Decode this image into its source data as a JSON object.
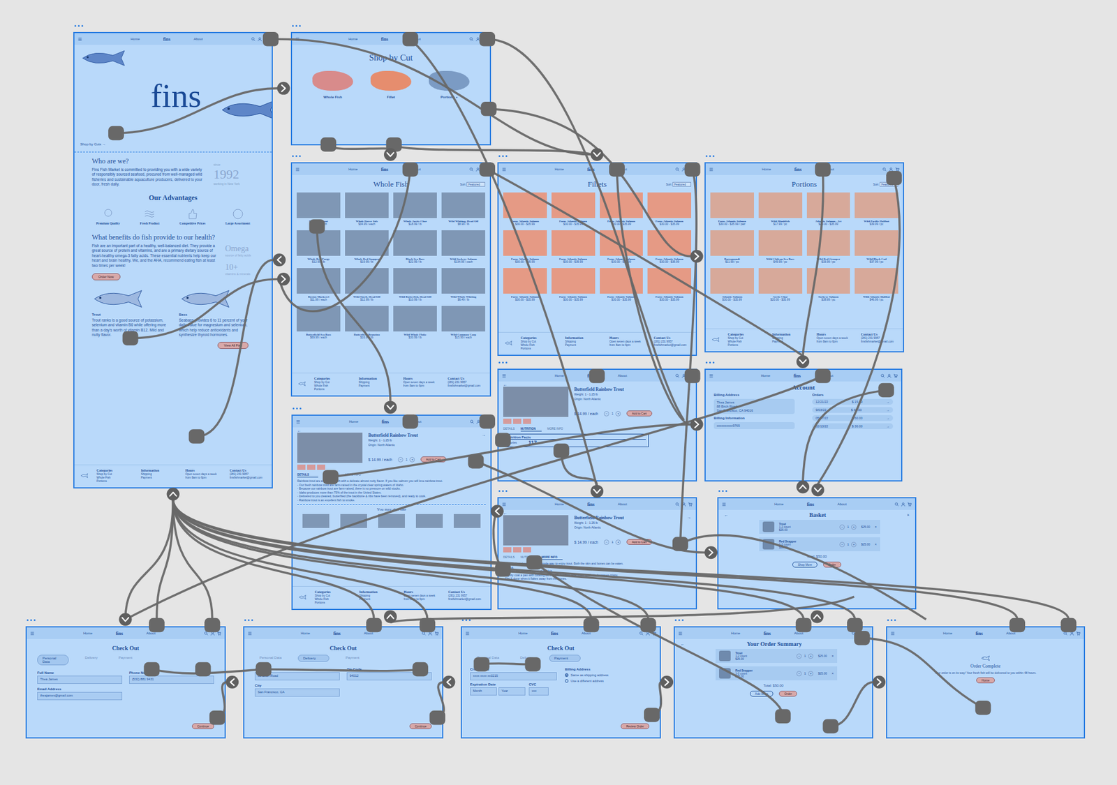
{
  "nav": {
    "home": "Home",
    "logo": "fins",
    "about": "About"
  },
  "controls": {
    "minus": "−",
    "plus": "+",
    "remove": "×",
    "back": "←",
    "next": "→"
  },
  "footer": {
    "columns": [
      {
        "title": "Categories",
        "items": [
          "Shop by Cut",
          "Whole Fish",
          "Portions"
        ]
      },
      {
        "title": "Information",
        "items": [
          "Shipping",
          "Payment"
        ]
      },
      {
        "title": "Hours",
        "items": [
          "Open seven days a week",
          "from 8am to 6pm"
        ]
      },
      {
        "title": "Contact Us",
        "items": [
          "(281) 231 9957",
          "finsfishmarket@gmail.com"
        ]
      }
    ]
  },
  "frames": [
    {
      "kind": "home",
      "logo": "fins",
      "shop_link": "Shop by Cuts →",
      "who_title": "Who are we?",
      "who_text": "Fins Fish Market is committed to providing you with a wide variety of responsibly sourced seafood, procured from well-managed wild fisheries and sustainable aquaculture producers, delivered to your door, fresh daily.",
      "since_label": "since",
      "year": "1992",
      "year_sub": "working in New York",
      "advantages_title": "Our Advantages",
      "advantages": [
        "Premium Quality",
        "Fresh Product",
        "Competitive Prices",
        "Large Assortment"
      ],
      "benefits_title": "What benefits do fish provide to our health?",
      "benefits_text": "Fish are an important part of a healthy, well-balanced diet. They provide a great source of protein and vitamins, and are a primary dietary source of heart-healthy omega-3 fatty acids. These essential nutrients help keep our heart and brain healthy. We, and the AHA, recommend eating fish at least two times per week!",
      "order_button": "Order Now",
      "stats": [
        {
          "value": "Omega",
          "label": "source of fatty acids"
        },
        {
          "value": "10+",
          "label": "vitamins & minerals"
        }
      ],
      "fish": [
        {
          "name": "Trout",
          "text": "Trout ranks is a good source of potassium, selenium and vitamin B6 while offering more than a day's worth of vitamin B12. Mild and nutty flavor."
        },
        {
          "name": "Bass",
          "text": "Seabass provides 6 to 11 percent of your daily value for magnesium and selenium, which help reduce antioxidants and synthesize thyroid hormones."
        }
      ],
      "view_button": "View All Fish"
    },
    {
      "kind": "cuts",
      "title": "Shop by Cut",
      "cuts": [
        "Whole Fish",
        "Fillet",
        "Portions +"
      ]
    },
    {
      "kind": "grid",
      "title": "Whole Fish",
      "sort_label": "Sort",
      "sort_value": "Featured",
      "items": [
        {
          "name": "Rainbow Trout",
          "price": "$14.99 / each"
        },
        {
          "name": "Whole Dover Sole",
          "price": "$34.99 / each"
        },
        {
          "name": "Whole Arctic Char",
          "price": "$18.99 / lb"
        },
        {
          "name": "Wild Whiting, Head Off",
          "price": "$8.99 / lb"
        },
        {
          "name": "Whole Red Porgy",
          "price": "$12.99 / lb"
        },
        {
          "name": "Whole Red Snapper",
          "price": "$19.99 / lb"
        },
        {
          "name": "Black Sea Bass",
          "price": "$22.99 / lb"
        },
        {
          "name": "Wild Sockeye Salmon",
          "price": "$134.99 / each"
        },
        {
          "name": "Boston Mackerel",
          "price": "$11.99 / each"
        },
        {
          "name": "Wild Smelt, Head Off",
          "price": "$12.99 / lb"
        },
        {
          "name": "Wild Butterfish, Head Off",
          "price": "$10.99 / lb"
        },
        {
          "name": "Wild Whole Whiting",
          "price": "$6.49 / lb"
        },
        {
          "name": "Butterfield Sea Bass",
          "price": "$69.99 / each"
        },
        {
          "name": "Butterfield Branzino",
          "price": "$16.99 / lb"
        },
        {
          "name": "Wild Whole Fluke",
          "price": "$30.99 / lb"
        },
        {
          "name": "Wild Common Carp",
          "price": "$15.99 / each"
        }
      ]
    },
    {
      "kind": "grid",
      "title": "Fillets",
      "sort_label": "Sort",
      "sort_value": "Featured",
      "items": [
        {
          "name": "Faroe Atlantic Salmon",
          "price": "$30.00 - $35.99"
        },
        {
          "name": "Faroe Atlantic Salmon",
          "price": "$30.00 - $35.99"
        },
        {
          "name": "Faroe Atlantic Salmon",
          "price": "$30.00 - $35.99"
        },
        {
          "name": "Faroe Atlantic Salmon",
          "price": "$30.00 - $35.99"
        },
        {
          "name": "Faroe Atlantic Salmon",
          "price": "$30.00 - $35.99"
        },
        {
          "name": "Faroe Atlantic Salmon",
          "price": "$30.00 - $35.99"
        },
        {
          "name": "Faroe Atlantic Salmon",
          "price": "$30.00 - $35.99"
        },
        {
          "name": "Faroe Atlantic Salmon",
          "price": "$30.00 - $35.99"
        },
        {
          "name": "Faroe Atlantic Salmon",
          "price": "$30.00 - $35.99"
        },
        {
          "name": "Faroe Atlantic Salmon",
          "price": "$30.00 - $35.99"
        },
        {
          "name": "Faroe Atlantic Salmon",
          "price": "$30.00 - $35.99"
        },
        {
          "name": "Faroe Atlantic Salmon",
          "price": "$30.00 - $35.99"
        }
      ]
    },
    {
      "kind": "grid",
      "title": "Portions",
      "sort_label": "Sort",
      "sort_value": "Featured",
      "items": [
        {
          "name": "Faroe Atlantic Salmon",
          "price": "$30.00 - $35.99 / pair"
        },
        {
          "name": "Wild Monkfish",
          "price": "$17.99 / pc"
        },
        {
          "name": "Atlantic Salmon - 2ct",
          "price": "$20.00 - $35.99"
        },
        {
          "name": "Wild Pacific Halibut",
          "price": "$39.99 / pc"
        },
        {
          "name": "Barramundi",
          "price": "$11.99 / pc"
        },
        {
          "name": "Wild Chilean Sea Bass",
          "price": "$49.99 / pc"
        },
        {
          "name": "Wild Red Grouper",
          "price": "$33.99 / pc"
        },
        {
          "name": "Wild Black Cod",
          "price": "$37.99 / pc"
        },
        {
          "name": "Atlantic Salmon",
          "price": "$30.00 - $35.99"
        },
        {
          "name": "Arctic Char",
          "price": "$20.00 - $35.99"
        },
        {
          "name": "Sockeye Salmon",
          "price": "$39.89 / pc"
        },
        {
          "name": "Wild Atlantic Halibut",
          "price": "$46.99 / pc"
        }
      ]
    },
    {
      "kind": "product",
      "variant": "details",
      "name": "Butterfield Rainbow Trout",
      "weight": "Weight: 1 - 1.25 lb",
      "origin": "Origin: North Atlantic",
      "price": "$ 14.99 / each",
      "qty": "1",
      "button": "Add to Cart",
      "tabs": [
        {
          "label": "DETAILS",
          "selected": true
        },
        {
          "label": "NUTRITION",
          "selected": false
        },
        {
          "label": "MORE INFO",
          "selected": false
        }
      ],
      "description": [
        "Rainbow trout are a soft flaky fish with a delicate almost nutty flavor. If you like salmon you will love rainbow trout.",
        "- Our fresh rainbow trout are farm-raised in the crystal clear spring waters of Idaho.",
        "- Because our rainbow trout are farm-raised, there is no pressure on wild stocks.",
        "- Idaho produces more than 75% of the trout in the United States.",
        "- Delivered to you cleaned, butterflied (the backbone & ribs have been removed), and ready to cook.",
        "- Rainbow trout is an excellent fish to smoke."
      ],
      "also_like": "You may also like"
    },
    {
      "kind": "product",
      "variant": "nutrition",
      "name": "Butterfield Rainbow Trout",
      "weight": "Weight: 1 - 1.25 lb",
      "origin": "Origin: North Atlantic",
      "price": "$ 14.99 / each",
      "qty": "1",
      "button": "Add to Cart",
      "tabs": [
        {
          "label": "DETAILS",
          "selected": false
        },
        {
          "label": "NUTRITION",
          "selected": true
        },
        {
          "label": "MORE INFO",
          "selected": false
        }
      ],
      "nutrition": {
        "title": "Nutrition Facts",
        "calories_label": "Calories",
        "calories": "117"
      }
    },
    {
      "kind": "product",
      "variant": "info",
      "name": "Butterfield Rainbow Trout",
      "weight": "Weight: 1 - 1.25 lb",
      "origin": "Origin: North Atlantic",
      "price": "$ 14.99 / each",
      "qty": "1",
      "button": "Add to Cart",
      "tabs": [
        {
          "label": "DETAILS",
          "selected": false
        },
        {
          "label": "NUTRITION",
          "selected": false
        },
        {
          "label": "MORE INFO",
          "selected": true
        }
      ],
      "info": [
        "Butterflied rainbow trout is a simple way to enjoy trout. Both the skin and bones can be eaten.",
        "To cook:",
        "- Season the skin and meat of the fish.",
        "- Lightly coat a pan with cooking oil. Fry the fish skin side down until skin becomes crispy.",
        "- Flip & done when it flakes away from the bones."
      ]
    },
    {
      "kind": "account",
      "title": "Account",
      "billing_title": "Billing Address",
      "address": [
        "Thea James",
        "88 Birch Road",
        "San Francisco, CA 94016"
      ],
      "info_title": "Billing Information",
      "card": "xxxxxxxxxx9765",
      "orders_title": "Orders",
      "orders": [
        {
          "date": "12/21/22",
          "total": "$ 15.00"
        },
        {
          "date": "9/03/22",
          "total": "$ 45.00"
        },
        {
          "date": "05/17/22",
          "total": "$ 60.00"
        },
        {
          "date": "02/13/22",
          "total": "$ 30.00"
        }
      ]
    },
    {
      "kind": "basket",
      "title": "Basket",
      "items": [
        {
          "name": "Trout",
          "sub": "1-2 count",
          "unit": "$25.00",
          "qty": "1",
          "price": "$25.00"
        },
        {
          "name": "Red Snapper",
          "sub": "1-2 count",
          "unit": "$25.00",
          "qty": "1",
          "price": "$25.00"
        }
      ],
      "total": "Total: $50.00",
      "buttons": [
        "Shop More",
        "Order"
      ]
    },
    {
      "kind": "checkout",
      "title": "Check Out",
      "steps": [
        {
          "label": "Personal Data",
          "selected": true
        },
        {
          "label": "Delivery",
          "selected": false
        },
        {
          "label": "Payment",
          "selected": false
        }
      ],
      "fields": [
        {
          "label": "Full Name",
          "value": "Thea James"
        },
        {
          "label": "Phone Number",
          "value": "(532) 881 9431"
        },
        {
          "label": "Email Address",
          "value": "theajames@gmail.com"
        }
      ],
      "button": "Continue"
    },
    {
      "kind": "checkout",
      "title": "Check Out",
      "steps": [
        {
          "label": "Personal Data",
          "selected": false
        },
        {
          "label": "Delivery",
          "selected": true
        },
        {
          "label": "Payment",
          "selected": false
        }
      ],
      "fields": [
        {
          "label": "Address",
          "value": "88 Birch Road"
        },
        {
          "label": "Zip Code",
          "value": "94012"
        },
        {
          "label": "City",
          "value": "San Francisco, CA"
        }
      ],
      "button": "Continue"
    },
    {
      "kind": "payment",
      "title": "Check Out",
      "steps": [
        {
          "label": "Personal Data",
          "selected": false
        },
        {
          "label": "Delivery",
          "selected": false
        },
        {
          "label": "Payment",
          "selected": true
        }
      ],
      "card": {
        "label": "Credit Card",
        "value": "xxxx xxxx xx3215"
      },
      "expiry": {
        "label": "Expiration Date",
        "month": "Month",
        "year": "Year"
      },
      "cvc": {
        "label": "CVC",
        "value": "xxx"
      },
      "billing": {
        "label": "Billing Address",
        "options": [
          {
            "label": "Same as shipping address",
            "selected": true
          },
          {
            "label": "Use a different address",
            "selected": false
          }
        ]
      },
      "button": "Review Order"
    },
    {
      "kind": "summary",
      "title": "Your Order Summary",
      "items": [
        {
          "name": "Trout",
          "sub": "1-2 count",
          "unit": "$25.00",
          "qty": "1",
          "price": "$25.00"
        },
        {
          "name": "Red Snapper",
          "sub": "1-2 count",
          "unit": "$25.00",
          "qty": "1",
          "price": "$25.00"
        }
      ],
      "total": "Total: $50.00",
      "buttons": [
        "Add Items",
        "Order"
      ]
    },
    {
      "kind": "complete",
      "title": "Order Complete",
      "text": "Your order is on its way! Your fresh fish will be delivered to you within 48 hours.",
      "button": "Home"
    }
  ]
}
